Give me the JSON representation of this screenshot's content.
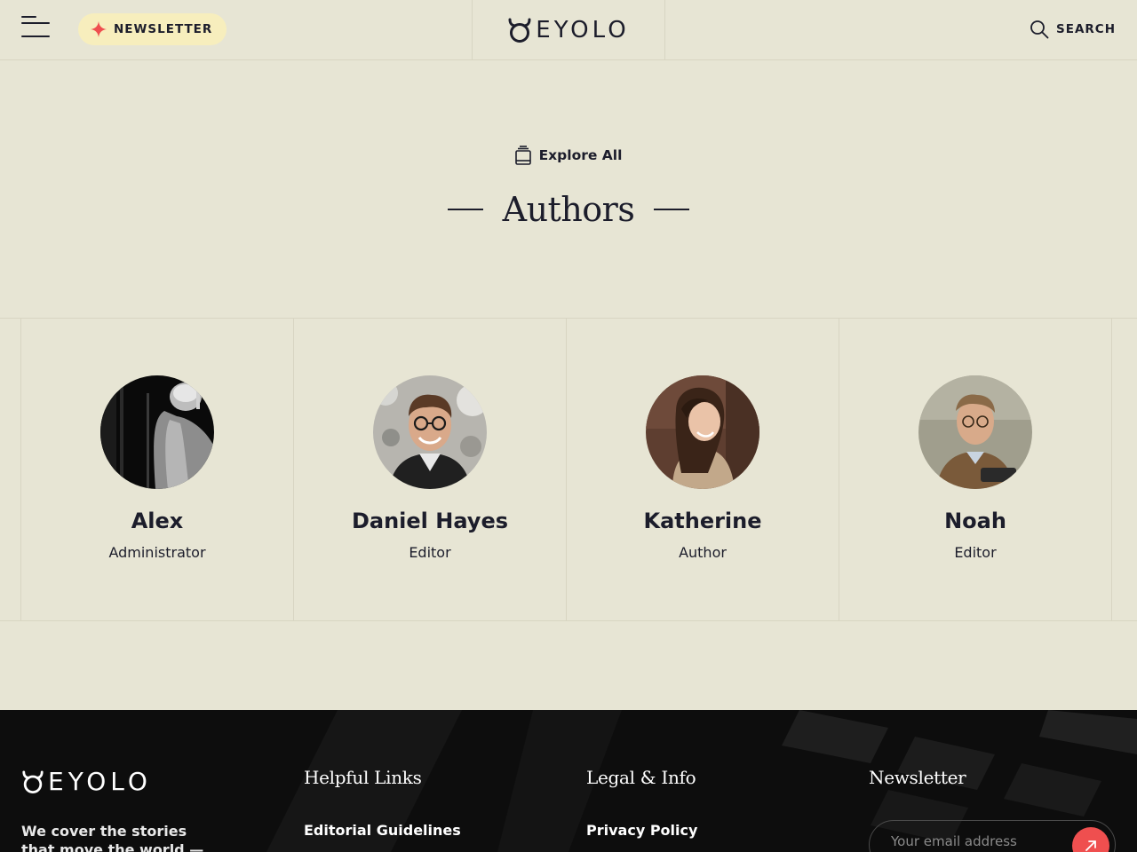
{
  "header": {
    "newsletter_label": "NEWSLETTER",
    "logo_text": "EYOLO",
    "search_label": "SEARCH"
  },
  "section": {
    "explore_label": "Explore All",
    "title": "Authors"
  },
  "authors": [
    {
      "name": "Alex",
      "role": "Administrator"
    },
    {
      "name": "Daniel Hayes",
      "role": "Editor"
    },
    {
      "name": "Katherine",
      "role": "Author"
    },
    {
      "name": "Noah",
      "role": "Editor"
    }
  ],
  "footer": {
    "logo_text": "EYOLO",
    "tagline": "We cover the stories that move the world — from",
    "columns": [
      {
        "title": "Helpful Links",
        "first_link": "Editorial Guidelines"
      },
      {
        "title": "Legal & Info",
        "first_link": "Privacy Policy"
      },
      {
        "title": "Newsletter"
      }
    ],
    "email_placeholder": "Your email address"
  },
  "colors": {
    "background": "#e7e5d4",
    "text": "#1c1d2b",
    "accent": "#ef4f4f",
    "pill": "#f7eebd",
    "footer_bg": "#0d0d0d"
  }
}
